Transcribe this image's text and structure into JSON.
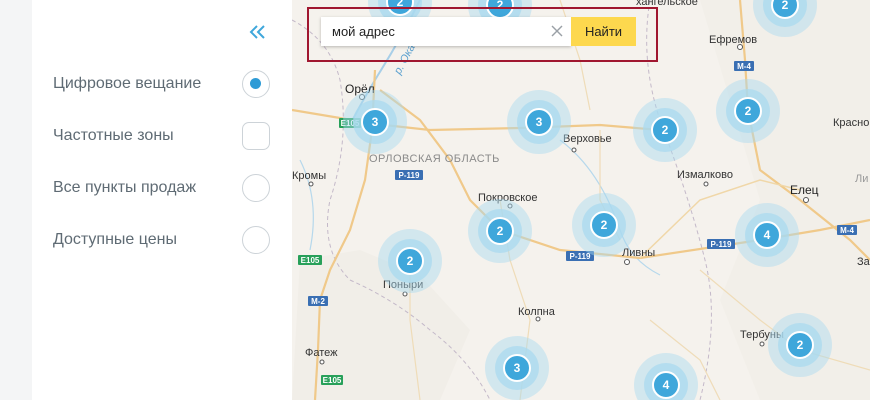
{
  "sidebar": {
    "collapse_icon": "double-chevron-left-icon",
    "options": [
      {
        "label": "Цифровое вещание",
        "control": "radio",
        "selected": true
      },
      {
        "label": "Частотные зоны",
        "control": "checkbox",
        "selected": false
      },
      {
        "label": "Все пункты продаж",
        "control": "radio",
        "selected": false
      },
      {
        "label": "Доступные цены",
        "control": "radio",
        "selected": false
      }
    ]
  },
  "search": {
    "value": "мой адрес",
    "button_label": "Найти",
    "clear_icon": "close-icon"
  },
  "map": {
    "region_label": "ОРЛОВСКАЯ ОБЛАСТЬ",
    "towns": {
      "orel": "Орёл",
      "verkhovye": "Верховье",
      "efremov": "Ефремов",
      "kromy": "Кромы",
      "pokrovskoe": "Покровское",
      "izmalkovo": "Измалково",
      "elets": "Елец",
      "livny": "Ливны",
      "ponyri": "Поныри",
      "kolpna": "Колпна",
      "fatezh": "Фатеж",
      "terbuny": "Тербуны",
      "arkhangelskoe": "хангельское",
      "krasno": "Красно",
      "za": "За",
      "li": "Ли"
    },
    "river_label": "р. Ока",
    "road_labels": {
      "e105_a": "E105",
      "e105_b": "E105",
      "e105_c": "E105",
      "r119_a": "Р-119",
      "r119_b": "Р-119",
      "r119_c": "Р-119",
      "m4_a": "М-4",
      "m4_b": "М-4",
      "m2": "М-2"
    },
    "clusters": [
      {
        "count": "2"
      },
      {
        "count": "2"
      },
      {
        "count": "3"
      },
      {
        "count": "3"
      },
      {
        "count": "2"
      },
      {
        "count": "2"
      },
      {
        "count": "2"
      },
      {
        "count": "2"
      },
      {
        "count": "2"
      },
      {
        "count": "4"
      },
      {
        "count": "2"
      },
      {
        "count": "3"
      },
      {
        "count": "4"
      },
      {
        "count": "2"
      }
    ],
    "colors": {
      "cluster_core": "#3fa7db",
      "cluster_halo": "#a9d9ef",
      "highlight_frame": "#a01730",
      "search_button": "#fdd84e",
      "radio_selected": "#2e9bd6"
    }
  }
}
